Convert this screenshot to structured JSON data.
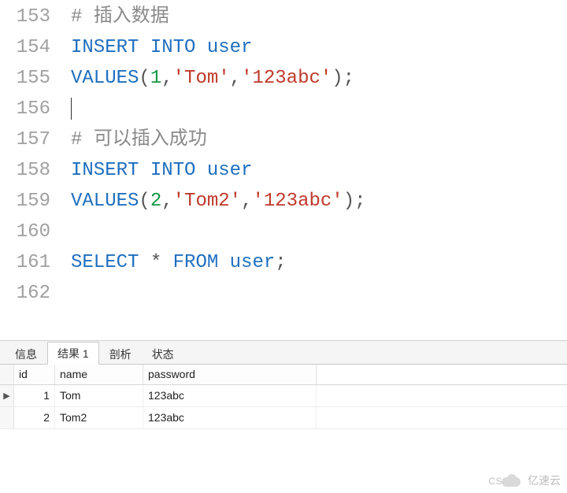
{
  "editor": {
    "lines": [
      {
        "num": "153",
        "tokens": [
          {
            "cls": "tok-comment",
            "t": "# "
          },
          {
            "cls": "tok-comment",
            "t": "插入数据"
          }
        ]
      },
      {
        "num": "154",
        "tokens": [
          {
            "cls": "tok-keyword",
            "t": "INSERT"
          },
          {
            "cls": "tok-punct",
            "t": " "
          },
          {
            "cls": "tok-keyword",
            "t": "INTO"
          },
          {
            "cls": "tok-punct",
            "t": " "
          },
          {
            "cls": "tok-keyword",
            "t": "user"
          }
        ]
      },
      {
        "num": "155",
        "tokens": [
          {
            "cls": "tok-keyword",
            "t": "VALUES"
          },
          {
            "cls": "tok-punct",
            "t": "("
          },
          {
            "cls": "tok-num",
            "t": "1"
          },
          {
            "cls": "tok-punct",
            "t": ","
          },
          {
            "cls": "tok-str",
            "t": "'Tom'"
          },
          {
            "cls": "tok-punct",
            "t": ","
          },
          {
            "cls": "tok-str",
            "t": "'123abc'"
          },
          {
            "cls": "tok-punct",
            "t": ");"
          }
        ]
      },
      {
        "num": "156",
        "cursor": true,
        "tokens": []
      },
      {
        "num": "157",
        "tokens": [
          {
            "cls": "tok-comment",
            "t": "# "
          },
          {
            "cls": "tok-comment",
            "t": "可以插入成功"
          }
        ]
      },
      {
        "num": "158",
        "tokens": [
          {
            "cls": "tok-keyword",
            "t": "INSERT"
          },
          {
            "cls": "tok-punct",
            "t": " "
          },
          {
            "cls": "tok-keyword",
            "t": "INTO"
          },
          {
            "cls": "tok-punct",
            "t": " "
          },
          {
            "cls": "tok-keyword",
            "t": "user"
          }
        ]
      },
      {
        "num": "159",
        "tokens": [
          {
            "cls": "tok-keyword",
            "t": "VALUES"
          },
          {
            "cls": "tok-punct",
            "t": "("
          },
          {
            "cls": "tok-num",
            "t": "2"
          },
          {
            "cls": "tok-punct",
            "t": ","
          },
          {
            "cls": "tok-str",
            "t": "'Tom2'"
          },
          {
            "cls": "tok-punct",
            "t": ","
          },
          {
            "cls": "tok-str",
            "t": "'123abc'"
          },
          {
            "cls": "tok-punct",
            "t": ");"
          }
        ]
      },
      {
        "num": "160",
        "tokens": []
      },
      {
        "num": "161",
        "tokens": [
          {
            "cls": "tok-keyword",
            "t": "SELECT"
          },
          {
            "cls": "tok-punct",
            "t": " "
          },
          {
            "cls": "tok-op",
            "t": "*"
          },
          {
            "cls": "tok-punct",
            "t": " "
          },
          {
            "cls": "tok-keyword",
            "t": "FROM"
          },
          {
            "cls": "tok-punct",
            "t": " "
          },
          {
            "cls": "tok-keyword",
            "t": "user"
          },
          {
            "cls": "tok-punct",
            "t": ";"
          }
        ]
      },
      {
        "num": "162",
        "tokens": []
      }
    ]
  },
  "tabs": {
    "items": [
      {
        "label": "信息",
        "active": false
      },
      {
        "label": "结果 1",
        "active": true
      },
      {
        "label": "剖析",
        "active": false
      },
      {
        "label": "状态",
        "active": false
      }
    ]
  },
  "grid": {
    "columns": [
      {
        "key": "id",
        "label": "id"
      },
      {
        "key": "name",
        "label": "name"
      },
      {
        "key": "password",
        "label": "password"
      }
    ],
    "rows": [
      {
        "current": true,
        "id": "1",
        "name": "Tom",
        "password": "123abc"
      },
      {
        "current": false,
        "id": "2",
        "name": "Tom2",
        "password": "123abc"
      }
    ]
  },
  "watermark": {
    "text": "亿速云",
    "cs": "CS"
  }
}
